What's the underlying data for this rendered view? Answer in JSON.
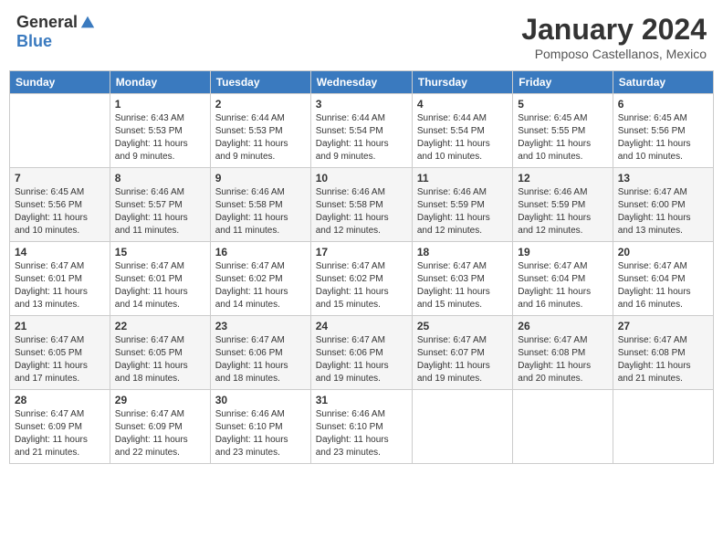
{
  "header": {
    "logo_general": "General",
    "logo_blue": "Blue",
    "month_title": "January 2024",
    "location": "Pomposo Castellanos, Mexico"
  },
  "days_of_week": [
    "Sunday",
    "Monday",
    "Tuesday",
    "Wednesday",
    "Thursday",
    "Friday",
    "Saturday"
  ],
  "weeks": [
    [
      {
        "day": "",
        "info": ""
      },
      {
        "day": "1",
        "info": "Sunrise: 6:43 AM\nSunset: 5:53 PM\nDaylight: 11 hours\nand 9 minutes."
      },
      {
        "day": "2",
        "info": "Sunrise: 6:44 AM\nSunset: 5:53 PM\nDaylight: 11 hours\nand 9 minutes."
      },
      {
        "day": "3",
        "info": "Sunrise: 6:44 AM\nSunset: 5:54 PM\nDaylight: 11 hours\nand 9 minutes."
      },
      {
        "day": "4",
        "info": "Sunrise: 6:44 AM\nSunset: 5:54 PM\nDaylight: 11 hours\nand 10 minutes."
      },
      {
        "day": "5",
        "info": "Sunrise: 6:45 AM\nSunset: 5:55 PM\nDaylight: 11 hours\nand 10 minutes."
      },
      {
        "day": "6",
        "info": "Sunrise: 6:45 AM\nSunset: 5:56 PM\nDaylight: 11 hours\nand 10 minutes."
      }
    ],
    [
      {
        "day": "7",
        "info": "Sunrise: 6:45 AM\nSunset: 5:56 PM\nDaylight: 11 hours\nand 10 minutes."
      },
      {
        "day": "8",
        "info": "Sunrise: 6:46 AM\nSunset: 5:57 PM\nDaylight: 11 hours\nand 11 minutes."
      },
      {
        "day": "9",
        "info": "Sunrise: 6:46 AM\nSunset: 5:58 PM\nDaylight: 11 hours\nand 11 minutes."
      },
      {
        "day": "10",
        "info": "Sunrise: 6:46 AM\nSunset: 5:58 PM\nDaylight: 11 hours\nand 12 minutes."
      },
      {
        "day": "11",
        "info": "Sunrise: 6:46 AM\nSunset: 5:59 PM\nDaylight: 11 hours\nand 12 minutes."
      },
      {
        "day": "12",
        "info": "Sunrise: 6:46 AM\nSunset: 5:59 PM\nDaylight: 11 hours\nand 12 minutes."
      },
      {
        "day": "13",
        "info": "Sunrise: 6:47 AM\nSunset: 6:00 PM\nDaylight: 11 hours\nand 13 minutes."
      }
    ],
    [
      {
        "day": "14",
        "info": "Sunrise: 6:47 AM\nSunset: 6:01 PM\nDaylight: 11 hours\nand 13 minutes."
      },
      {
        "day": "15",
        "info": "Sunrise: 6:47 AM\nSunset: 6:01 PM\nDaylight: 11 hours\nand 14 minutes."
      },
      {
        "day": "16",
        "info": "Sunrise: 6:47 AM\nSunset: 6:02 PM\nDaylight: 11 hours\nand 14 minutes."
      },
      {
        "day": "17",
        "info": "Sunrise: 6:47 AM\nSunset: 6:02 PM\nDaylight: 11 hours\nand 15 minutes."
      },
      {
        "day": "18",
        "info": "Sunrise: 6:47 AM\nSunset: 6:03 PM\nDaylight: 11 hours\nand 15 minutes."
      },
      {
        "day": "19",
        "info": "Sunrise: 6:47 AM\nSunset: 6:04 PM\nDaylight: 11 hours\nand 16 minutes."
      },
      {
        "day": "20",
        "info": "Sunrise: 6:47 AM\nSunset: 6:04 PM\nDaylight: 11 hours\nand 16 minutes."
      }
    ],
    [
      {
        "day": "21",
        "info": "Sunrise: 6:47 AM\nSunset: 6:05 PM\nDaylight: 11 hours\nand 17 minutes."
      },
      {
        "day": "22",
        "info": "Sunrise: 6:47 AM\nSunset: 6:05 PM\nDaylight: 11 hours\nand 18 minutes."
      },
      {
        "day": "23",
        "info": "Sunrise: 6:47 AM\nSunset: 6:06 PM\nDaylight: 11 hours\nand 18 minutes."
      },
      {
        "day": "24",
        "info": "Sunrise: 6:47 AM\nSunset: 6:06 PM\nDaylight: 11 hours\nand 19 minutes."
      },
      {
        "day": "25",
        "info": "Sunrise: 6:47 AM\nSunset: 6:07 PM\nDaylight: 11 hours\nand 19 minutes."
      },
      {
        "day": "26",
        "info": "Sunrise: 6:47 AM\nSunset: 6:08 PM\nDaylight: 11 hours\nand 20 minutes."
      },
      {
        "day": "27",
        "info": "Sunrise: 6:47 AM\nSunset: 6:08 PM\nDaylight: 11 hours\nand 21 minutes."
      }
    ],
    [
      {
        "day": "28",
        "info": "Sunrise: 6:47 AM\nSunset: 6:09 PM\nDaylight: 11 hours\nand 21 minutes."
      },
      {
        "day": "29",
        "info": "Sunrise: 6:47 AM\nSunset: 6:09 PM\nDaylight: 11 hours\nand 22 minutes."
      },
      {
        "day": "30",
        "info": "Sunrise: 6:46 AM\nSunset: 6:10 PM\nDaylight: 11 hours\nand 23 minutes."
      },
      {
        "day": "31",
        "info": "Sunrise: 6:46 AM\nSunset: 6:10 PM\nDaylight: 11 hours\nand 23 minutes."
      },
      {
        "day": "",
        "info": ""
      },
      {
        "day": "",
        "info": ""
      },
      {
        "day": "",
        "info": ""
      }
    ]
  ]
}
